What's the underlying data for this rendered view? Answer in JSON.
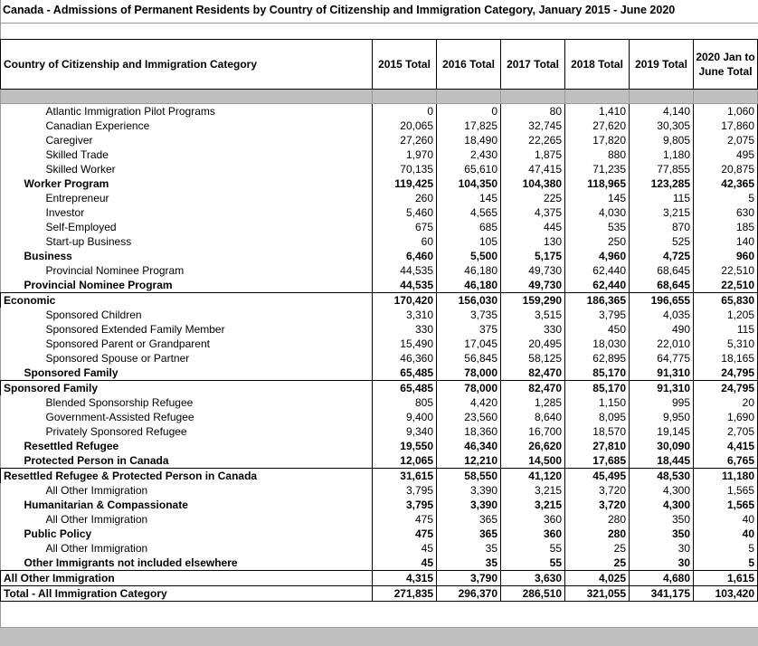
{
  "title": "Canada - Admissions of Permanent Residents by Country of Citizenship and Immigration Category, January 2015 - June 2020",
  "header": {
    "label": "Country of Citizenship and Immigration Category",
    "years": [
      "2015 Total",
      "2016 Total",
      "2017 Total",
      "2018 Total",
      "2019 Total",
      "2020 Jan to June Total"
    ]
  },
  "rows": [
    {
      "label": "Atlantic Immigration Pilot Programs",
      "level": 2,
      "bold": false,
      "values": [
        "0",
        "0",
        "80",
        "1,410",
        "4,140",
        "1,060"
      ]
    },
    {
      "label": "Canadian Experience",
      "level": 2,
      "bold": false,
      "values": [
        "20,065",
        "17,825",
        "32,745",
        "27,620",
        "30,305",
        "17,860"
      ]
    },
    {
      "label": "Caregiver",
      "level": 2,
      "bold": false,
      "values": [
        "27,260",
        "18,490",
        "22,265",
        "17,820",
        "9,805",
        "2,075"
      ]
    },
    {
      "label": "Skilled Trade",
      "level": 2,
      "bold": false,
      "values": [
        "1,970",
        "2,430",
        "1,875",
        "880",
        "1,180",
        "495"
      ]
    },
    {
      "label": "Skilled Worker",
      "level": 2,
      "bold": false,
      "values": [
        "70,135",
        "65,610",
        "47,415",
        "71,235",
        "77,855",
        "20,875"
      ]
    },
    {
      "label": "Worker Program",
      "level": 1,
      "bold": true,
      "values": [
        "119,425",
        "104,350",
        "104,380",
        "118,965",
        "123,285",
        "42,365"
      ]
    },
    {
      "label": "Entrepreneur",
      "level": 2,
      "bold": false,
      "values": [
        "260",
        "145",
        "225",
        "145",
        "115",
        "5"
      ]
    },
    {
      "label": "Investor",
      "level": 2,
      "bold": false,
      "values": [
        "5,460",
        "4,565",
        "4,375",
        "4,030",
        "3,215",
        "630"
      ]
    },
    {
      "label": "Self-Employed",
      "level": 2,
      "bold": false,
      "values": [
        "675",
        "685",
        "445",
        "535",
        "870",
        "185"
      ]
    },
    {
      "label": "Start-up Business",
      "level": 2,
      "bold": false,
      "values": [
        "60",
        "105",
        "130",
        "250",
        "525",
        "140"
      ]
    },
    {
      "label": "Business",
      "level": 1,
      "bold": true,
      "values": [
        "6,460",
        "5,500",
        "5,175",
        "4,960",
        "4,725",
        "960"
      ]
    },
    {
      "label": "Provincial Nominee Program",
      "level": 2,
      "bold": false,
      "values": [
        "44,535",
        "46,180",
        "49,730",
        "62,440",
        "68,645",
        "22,510"
      ]
    },
    {
      "label": "Provincial Nominee Program",
      "level": 1,
      "bold": true,
      "values": [
        "44,535",
        "46,180",
        "49,730",
        "62,440",
        "68,645",
        "22,510"
      ]
    },
    {
      "label": "Economic",
      "level": 0,
      "bold": true,
      "values": [
        "170,420",
        "156,030",
        "159,290",
        "186,365",
        "196,655",
        "65,830"
      ]
    },
    {
      "label": "Sponsored Children",
      "level": 2,
      "bold": false,
      "values": [
        "3,310",
        "3,735",
        "3,515",
        "3,795",
        "4,035",
        "1,205"
      ]
    },
    {
      "label": "Sponsored Extended Family Member",
      "level": 2,
      "bold": false,
      "values": [
        "330",
        "375",
        "330",
        "450",
        "490",
        "115"
      ]
    },
    {
      "label": "Sponsored Parent or Grandparent",
      "level": 2,
      "bold": false,
      "values": [
        "15,490",
        "17,045",
        "20,495",
        "18,030",
        "22,010",
        "5,310"
      ]
    },
    {
      "label": "Sponsored Spouse or Partner",
      "level": 2,
      "bold": false,
      "values": [
        "46,360",
        "56,845",
        "58,125",
        "62,895",
        "64,775",
        "18,165"
      ]
    },
    {
      "label": "Sponsored Family",
      "level": 1,
      "bold": true,
      "values": [
        "65,485",
        "78,000",
        "82,470",
        "85,170",
        "91,310",
        "24,795"
      ]
    },
    {
      "label": "Sponsored Family",
      "level": 0,
      "bold": true,
      "values": [
        "65,485",
        "78,000",
        "82,470",
        "85,170",
        "91,310",
        "24,795"
      ]
    },
    {
      "label": "Blended Sponsorship Refugee",
      "level": 2,
      "bold": false,
      "values": [
        "805",
        "4,420",
        "1,285",
        "1,150",
        "995",
        "20"
      ]
    },
    {
      "label": "Government-Assisted Refugee",
      "level": 2,
      "bold": false,
      "values": [
        "9,400",
        "23,560",
        "8,640",
        "8,095",
        "9,950",
        "1,690"
      ]
    },
    {
      "label": "Privately Sponsored Refugee",
      "level": 2,
      "bold": false,
      "values": [
        "9,340",
        "18,360",
        "16,700",
        "18,570",
        "19,145",
        "2,705"
      ]
    },
    {
      "label": "Resettled Refugee",
      "level": 1,
      "bold": true,
      "values": [
        "19,550",
        "46,340",
        "26,620",
        "27,810",
        "30,090",
        "4,415"
      ]
    },
    {
      "label": "Protected Person in Canada",
      "level": 1,
      "bold": true,
      "values": [
        "12,065",
        "12,210",
        "14,500",
        "17,685",
        "18,445",
        "6,765"
      ]
    },
    {
      "label": "Resettled Refugee & Protected Person in Canada",
      "level": 0,
      "bold": true,
      "values": [
        "31,615",
        "58,550",
        "41,120",
        "45,495",
        "48,530",
        "11,180"
      ]
    },
    {
      "label": "All Other Immigration",
      "level": 2,
      "bold": false,
      "values": [
        "3,795",
        "3,390",
        "3,215",
        "3,720",
        "4,300",
        "1,565"
      ]
    },
    {
      "label": "Humanitarian & Compassionate",
      "level": 1,
      "bold": true,
      "values": [
        "3,795",
        "3,390",
        "3,215",
        "3,720",
        "4,300",
        "1,565"
      ]
    },
    {
      "label": "All Other Immigration",
      "level": 2,
      "bold": false,
      "values": [
        "475",
        "365",
        "360",
        "280",
        "350",
        "40"
      ]
    },
    {
      "label": "Public Policy",
      "level": 1,
      "bold": true,
      "values": [
        "475",
        "365",
        "360",
        "280",
        "350",
        "40"
      ]
    },
    {
      "label": "All Other Immigration",
      "level": 2,
      "bold": false,
      "values": [
        "45",
        "35",
        "55",
        "25",
        "30",
        "5"
      ]
    },
    {
      "label": "Other Immigrants not included elsewhere",
      "level": 1,
      "bold": true,
      "values": [
        "45",
        "35",
        "55",
        "25",
        "30",
        "5"
      ]
    },
    {
      "label": "All Other Immigration",
      "level": 0,
      "bold": true,
      "values": [
        "4,315",
        "3,790",
        "3,630",
        "4,025",
        "4,680",
        "1,615"
      ]
    },
    {
      "label": "Total - All Immigration Category",
      "level": 0,
      "bold": true,
      "values": [
        "271,835",
        "296,370",
        "286,510",
        "321,055",
        "341,175",
        "103,420"
      ]
    }
  ]
}
